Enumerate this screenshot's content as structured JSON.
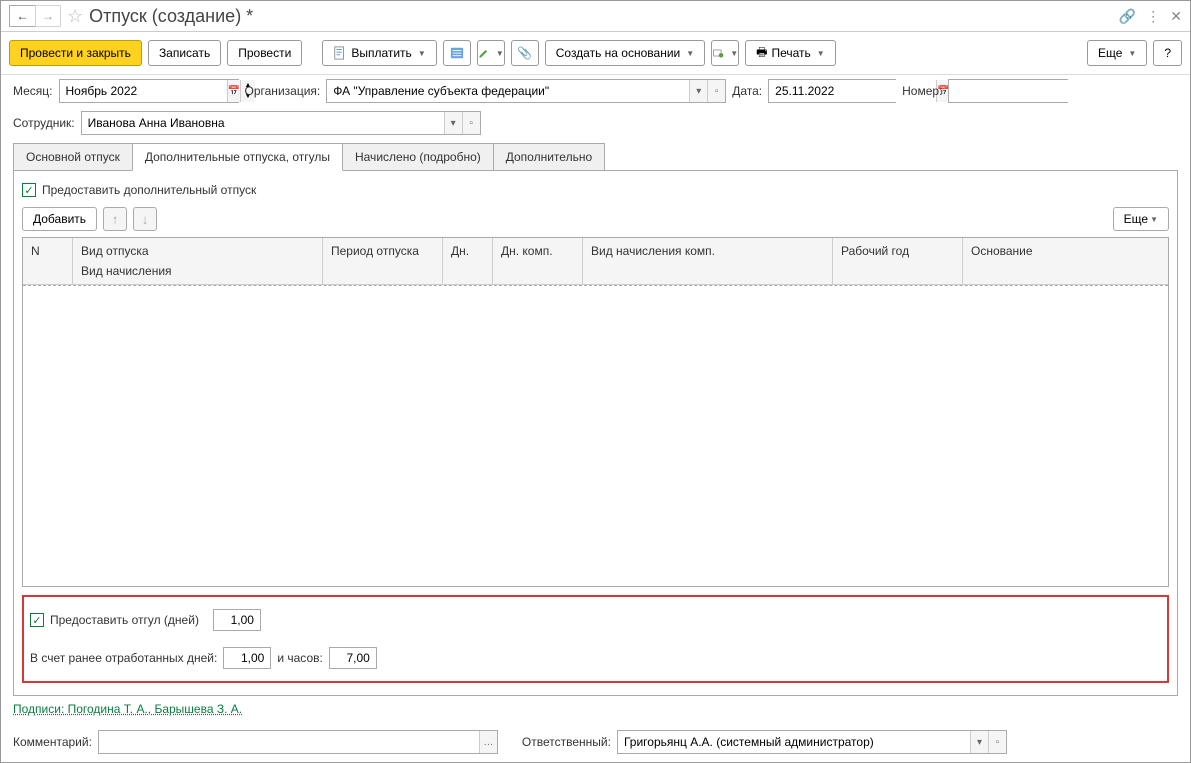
{
  "title": "Отпуск (создание) *",
  "toolbar": {
    "post_close": "Провести и закрыть",
    "save": "Записать",
    "post": "Провести",
    "pay": "Выплатить",
    "create_based": "Создать на основании",
    "print": "Печать",
    "more": "Еще",
    "help": "?"
  },
  "fields": {
    "month_label": "Месяц:",
    "month_value": "Ноябрь 2022",
    "org_label": "Организация:",
    "org_value": "ФА \"Управление субъекта федерации\"",
    "date_label": "Дата:",
    "date_value": "25.11.2022",
    "number_label": "Номер:",
    "number_value": "",
    "employee_label": "Сотрудник:",
    "employee_value": "Иванова Анна Ивановна"
  },
  "tabs": {
    "main": "Основной отпуск",
    "additional": "Дополнительные отпуска, отгулы",
    "accrued": "Начислено (подробно)",
    "extra": "Дополнительно"
  },
  "additional_tab": {
    "provide_additional": "Предоставить дополнительный отпуск",
    "add_btn": "Добавить",
    "more_btn": "Еще",
    "columns": {
      "n": "N",
      "vacation_type": "Вид отпуска",
      "accrual_type": "Вид начисления",
      "period": "Период отпуска",
      "days": "Дн.",
      "days_comp": "Дн. комп.",
      "comp_accrual": "Вид начисления комп.",
      "work_year": "Рабочий год",
      "basis": "Основание"
    },
    "day_off": {
      "provide_label": "Предоставить отгул (дней)",
      "provide_value": "1,00",
      "worked_days_label": "В счет ранее отработанных дней:",
      "worked_days_value": "1,00",
      "hours_label": "и часов:",
      "hours_value": "7,00"
    }
  },
  "signatures_link": "Подписи: Погодина Т. А., Барышева З. А.",
  "footer": {
    "comment_label": "Комментарий:",
    "comment_value": "",
    "responsible_label": "Ответственный:",
    "responsible_value": "Григорьянц А.А. (системный администратор)"
  }
}
